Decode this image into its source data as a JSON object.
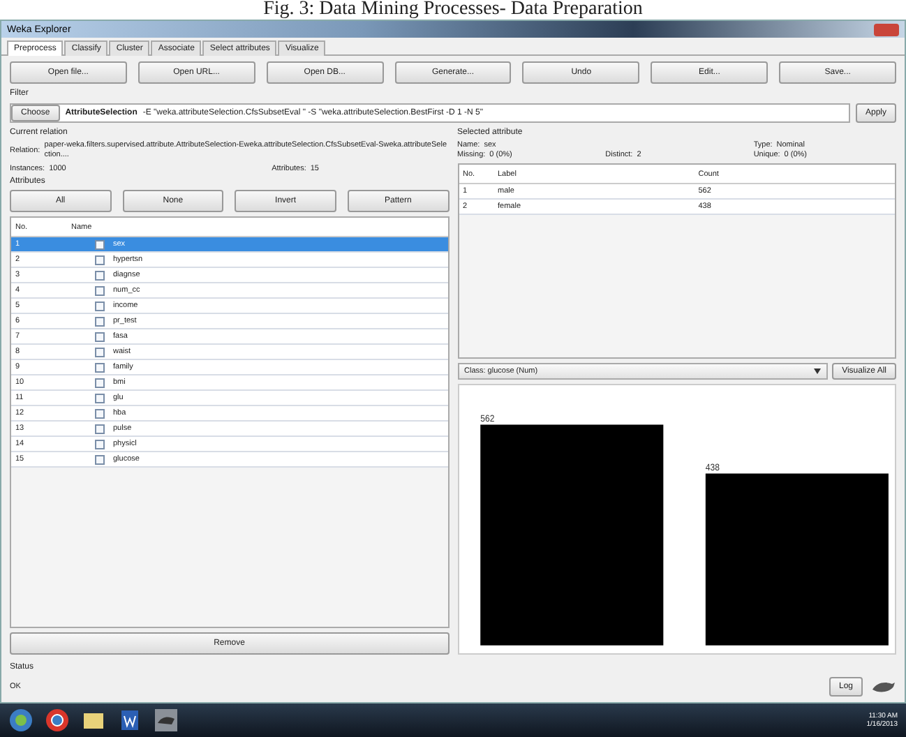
{
  "caption": "Fig. 3: Data Mining Processes- Data Preparation",
  "window": {
    "title": "Weka Explorer"
  },
  "tabs": [
    {
      "label": "Preprocess",
      "selected": true
    },
    {
      "label": "Classify",
      "selected": false
    },
    {
      "label": "Cluster",
      "selected": false
    },
    {
      "label": "Associate",
      "selected": false
    },
    {
      "label": "Select attributes",
      "selected": false
    },
    {
      "label": "Visualize",
      "selected": false
    }
  ],
  "toolbar": [
    "Open file...",
    "Open URL...",
    "Open DB...",
    "Generate...",
    "Undo",
    "Edit...",
    "Save..."
  ],
  "filter": {
    "heading": "Filter",
    "choose": "Choose",
    "name": "AttributeSelection",
    "options": "-E \"weka.attributeSelection.CfsSubsetEval \" -S \"weka.attributeSelection.BestFirst -D 1 -N 5\"",
    "apply": "Apply"
  },
  "current_relation": {
    "heading": "Current relation",
    "relation_label": "Relation:",
    "relation": "paper-weka.filters.supervised.attribute.AttributeSelection-Eweka.attributeSelection.CfsSubsetEval-Sweka.attributeSelection....",
    "instances_label": "Instances:",
    "instances": "1000",
    "attributes_label": "Attributes:",
    "attributes": "15"
  },
  "attributes": {
    "heading": "Attributes",
    "buttons": [
      "All",
      "None",
      "Invert",
      "Pattern"
    ],
    "columns": [
      "No.",
      "Name"
    ],
    "rows": [
      {
        "no": "1",
        "name": "sex",
        "checked": false,
        "selected": true
      },
      {
        "no": "2",
        "name": "hypertsn",
        "checked": false,
        "selected": false
      },
      {
        "no": "3",
        "name": "diagnse",
        "checked": false,
        "selected": false
      },
      {
        "no": "4",
        "name": "num_cc",
        "checked": false,
        "selected": false
      },
      {
        "no": "5",
        "name": "income",
        "checked": false,
        "selected": false
      },
      {
        "no": "6",
        "name": "pr_test",
        "checked": false,
        "selected": false
      },
      {
        "no": "7",
        "name": "fasa",
        "checked": false,
        "selected": false
      },
      {
        "no": "8",
        "name": "waist",
        "checked": false,
        "selected": false
      },
      {
        "no": "9",
        "name": "family",
        "checked": false,
        "selected": false
      },
      {
        "no": "10",
        "name": "bmi",
        "checked": false,
        "selected": false
      },
      {
        "no": "11",
        "name": "glu",
        "checked": false,
        "selected": false
      },
      {
        "no": "12",
        "name": "hba",
        "checked": false,
        "selected": false
      },
      {
        "no": "13",
        "name": "pulse",
        "checked": false,
        "selected": false
      },
      {
        "no": "14",
        "name": "physicl",
        "checked": false,
        "selected": false
      },
      {
        "no": "15",
        "name": "glucose",
        "checked": false,
        "selected": false
      }
    ],
    "remove": "Remove"
  },
  "selected_attribute": {
    "heading": "Selected attribute",
    "name_label": "Name:",
    "name": "sex",
    "type_label": "Type:",
    "type": "Nominal",
    "missing_label": "Missing:",
    "missing": "0 (0%)",
    "distinct_label": "Distinct:",
    "distinct": "2",
    "unique_label": "Unique:",
    "unique": "0 (0%)",
    "columns": [
      "No.",
      "Label",
      "Count"
    ],
    "rows": [
      {
        "no": "1",
        "label": "male",
        "count": "562"
      },
      {
        "no": "2",
        "label": "female",
        "count": "438"
      }
    ]
  },
  "class_select": {
    "value": "Class: glucose (Num)",
    "button": "Visualize All"
  },
  "histogram": {
    "bars": [
      "562",
      "438"
    ]
  },
  "status": {
    "heading": "Status",
    "message": "OK",
    "log": "Log"
  },
  "taskbar": {
    "time": "11:30 AM",
    "date": "1/16/2013"
  }
}
